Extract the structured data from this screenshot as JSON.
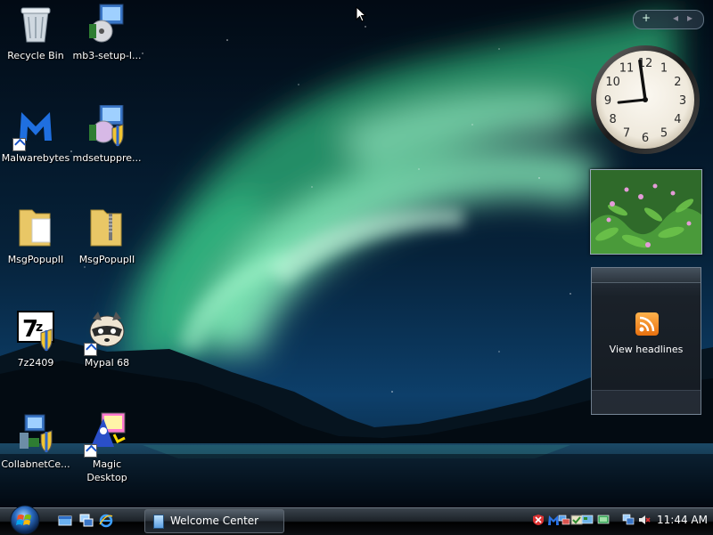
{
  "desktop": {
    "icons": [
      {
        "label": "Recycle Bin"
      },
      {
        "label": "mb3-setup-l..."
      },
      {
        "label": "Malwarebytes"
      },
      {
        "label": "mdsetuppre..."
      },
      {
        "label": "MsgPopupII"
      },
      {
        "label": "MsgPopupII"
      },
      {
        "label": "7z2409"
      },
      {
        "label": "Mypal 68"
      },
      {
        "label": "CollabnetCe..."
      },
      {
        "label": "Magic Desktop"
      }
    ]
  },
  "sidebar": {
    "add_gadget": "+",
    "prev": "◂",
    "next": "▸",
    "clock_numbers": [
      "12",
      "1",
      "2",
      "3",
      "4",
      "5",
      "6",
      "7",
      "8",
      "9",
      "10",
      "11"
    ],
    "clock_time": {
      "hour": 11,
      "minute": 44
    },
    "feed": {
      "label": "View headlines"
    }
  },
  "taskbar": {
    "open_window": "Welcome Center",
    "time": "11:44 AM"
  },
  "colors": {
    "aurora": "#3fc88a",
    "taskbar": "#1c2228",
    "rss": "#f08a24"
  }
}
